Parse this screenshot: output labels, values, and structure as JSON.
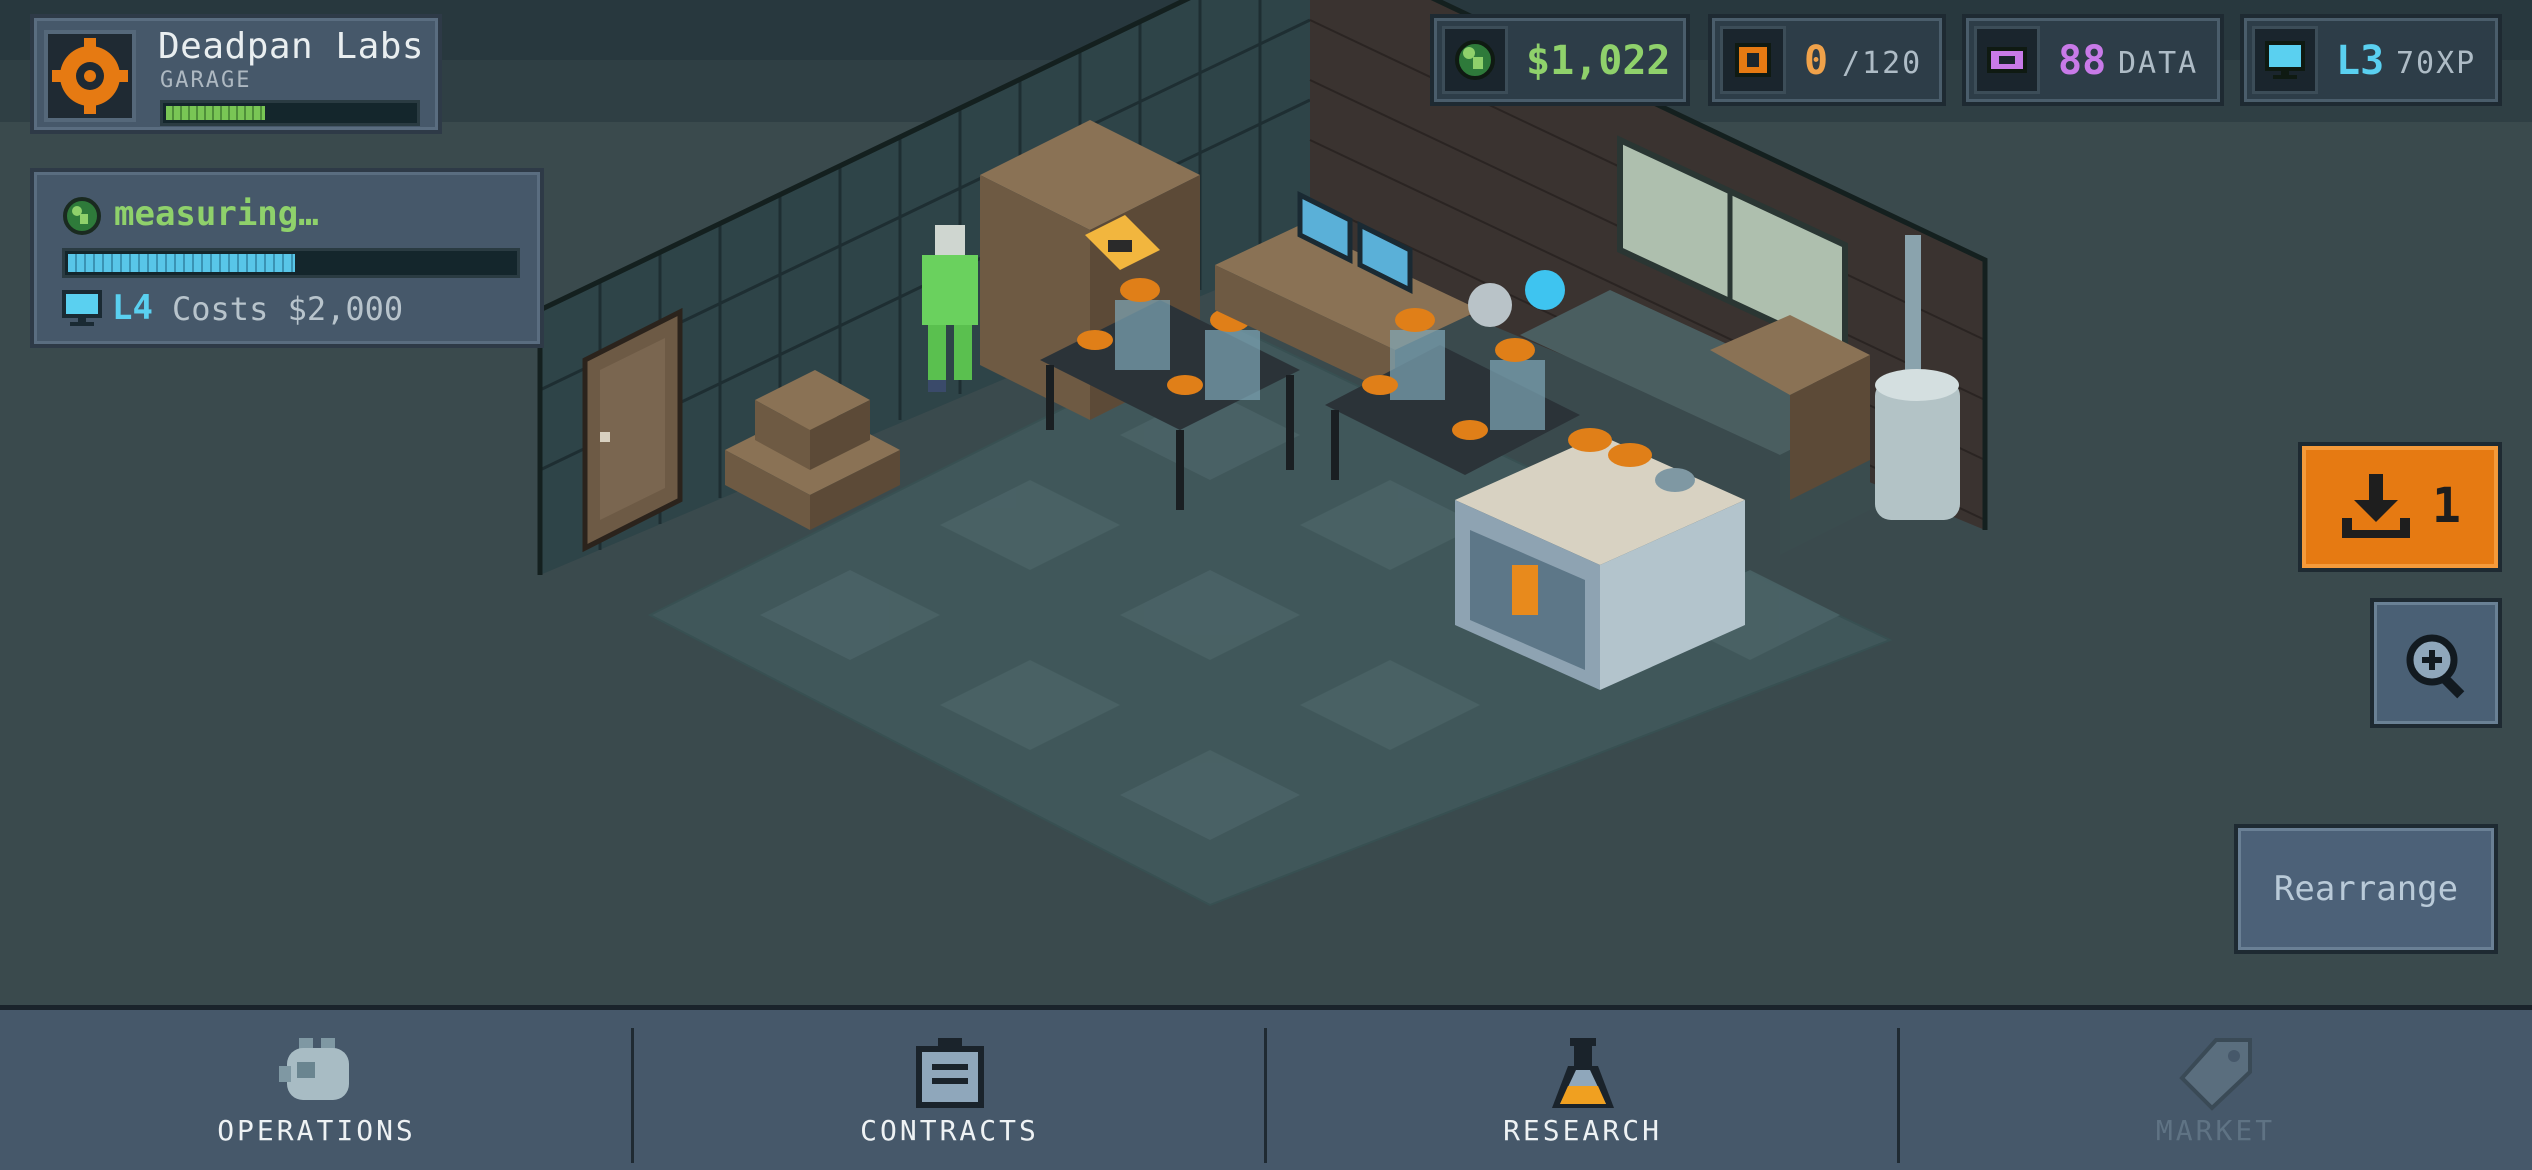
{
  "studio": {
    "name": "Deadpan Labs",
    "location": "GARAGE",
    "progress": 0.4
  },
  "task": {
    "status": "measuring…",
    "progress": 0.51,
    "level": "L4",
    "cost": "Costs $2,000"
  },
  "resources": {
    "money": {
      "value": "$1,022",
      "icon": "globe-coin-icon",
      "color": "#8fd16b"
    },
    "storage": {
      "value": "0",
      "unit": "/120",
      "icon": "crate-icon",
      "color": "#f0a24a"
    },
    "data": {
      "value": "88",
      "unit": "DATA",
      "icon": "data-chip-icon",
      "color": "#c87ae8"
    },
    "xp": {
      "value": "L3",
      "unit": "70XP",
      "icon": "monitor-icon",
      "color": "#5ad0f0"
    }
  },
  "actions": {
    "import_count": "1",
    "rearrange_label": "Rearrange"
  },
  "nav": {
    "items": [
      {
        "label": "OPERATIONS",
        "icon": "operations-icon",
        "enabled": true
      },
      {
        "label": "CONTRACTS",
        "icon": "clipboard-icon",
        "enabled": true
      },
      {
        "label": "RESEARCH",
        "icon": "flask-icon",
        "enabled": true
      },
      {
        "label": "MARKET",
        "icon": "tag-icon",
        "enabled": false
      }
    ]
  },
  "colors": {
    "accent_orange": "#e67a12",
    "panel": "#46586a",
    "background": "#3a4a4d"
  }
}
